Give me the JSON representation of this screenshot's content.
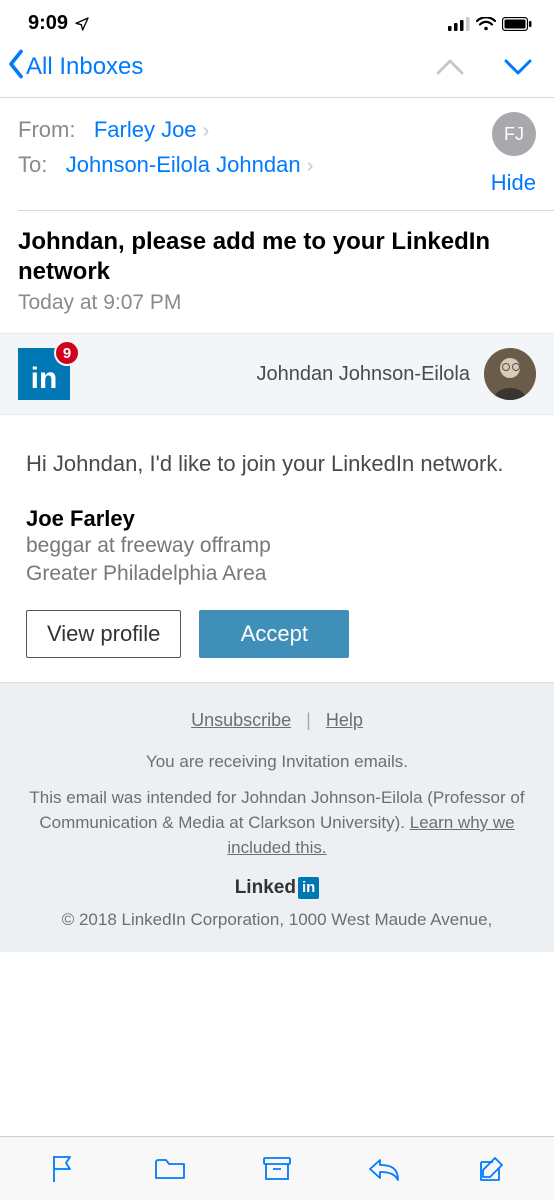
{
  "statusbar": {
    "time": "9:09"
  },
  "navbar": {
    "back_label": "All Inboxes"
  },
  "header": {
    "from_label": "From:",
    "from_name": "Farley Joe",
    "to_label": "To:",
    "to_name": "Johnson-Eilola Johndan",
    "hide_label": "Hide",
    "avatar_initials": "FJ"
  },
  "subject": {
    "text": "Johndan, please add me to your LinkedIn network",
    "date": "Today at 9:07 PM"
  },
  "linkedin_banner": {
    "badge_count": "9",
    "recipient": "Johndan Johnson-Eilola"
  },
  "body": {
    "greeting": "Hi Johndan, I'd like to join your LinkedIn network.",
    "sender_name": "Joe Farley",
    "sender_role": "beggar at freeway offramp",
    "sender_location": "Greater Philadelphia Area",
    "view_profile_label": "View profile",
    "accept_label": "Accept"
  },
  "footer": {
    "unsubscribe": "Unsubscribe",
    "help": "Help",
    "reason": "You are receiving Invitation emails.",
    "intended": "This email was intended for Johndan Johnson-Eilola (Professor of Communication & Media at Clarkson University). ",
    "learn": "Learn why we included this.",
    "brand": "Linked",
    "brand_in": "in",
    "copyright": "© 2018 LinkedIn Corporation, 1000 West Maude Avenue,"
  }
}
